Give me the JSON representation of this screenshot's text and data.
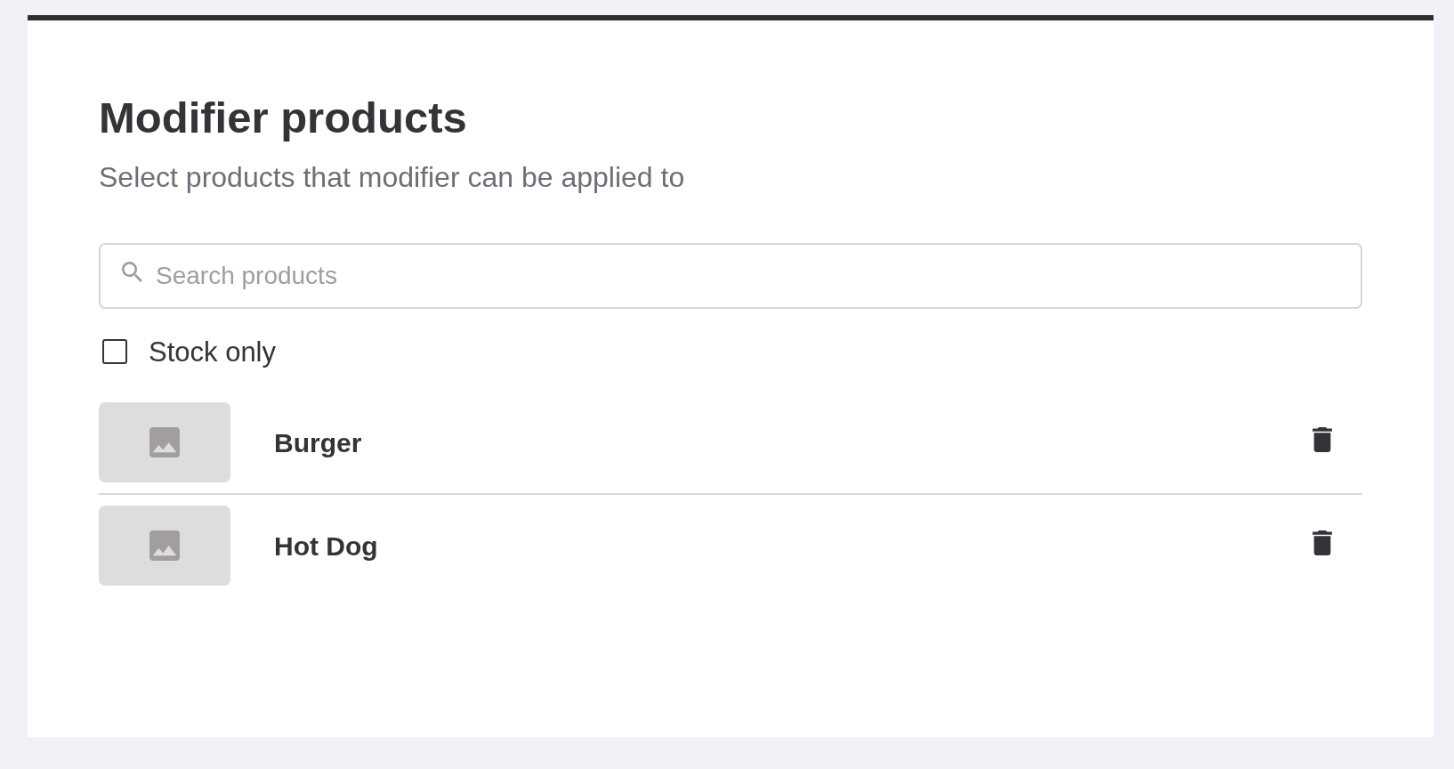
{
  "header": {
    "title": "Modifier products",
    "subtitle": "Select products that modifier can be applied to"
  },
  "search": {
    "placeholder": "Search products"
  },
  "filter": {
    "label": "Stock only",
    "checked": false
  },
  "products": [
    {
      "name": "Burger"
    },
    {
      "name": "Hot Dog"
    }
  ]
}
